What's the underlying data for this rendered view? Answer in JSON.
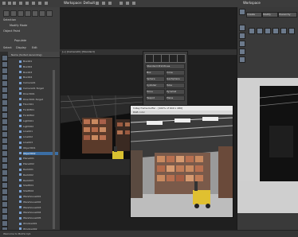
{
  "app": {
    "title": "Workspace: Default",
    "right_title": "Workspace"
  },
  "ribbon": {
    "labels": [
      "Selection",
      "Modify Mode",
      "Object Paint",
      "Populate"
    ],
    "subtabs": [
      "Select",
      "Display",
      "Edit"
    ]
  },
  "viewport": {
    "label": "[+] [Camera01] [Standard]"
  },
  "explorer": {
    "header": "Name (Sorted Ascending)",
    "rows": [
      "Box001",
      "Box002",
      "Box003",
      "Box004",
      "Camera01",
      "Camera01.Target",
      "Direct001",
      "Direct001.Target",
      "Floor001",
      "Forklift01",
      "Forklift02",
      "Light001",
      "Light002",
      "Line001",
      "Line002",
      "Line003",
      "Object001",
      "Object002",
      "Plane001",
      "Plane002",
      "Rack001",
      "Rack002",
      "Rack003",
      "Shelf001",
      "Shelf002",
      "Warehouse001",
      "Warehouse002",
      "Warehouse003",
      "Warehouse004",
      "Warehouse005",
      "Window001",
      "Window002"
    ],
    "selected_index": 17
  },
  "matpanel": {
    "title": "Standard Primitives",
    "buttons": [
      "Box",
      "Cone",
      "Sphere",
      "GeoSphere",
      "Cylinder",
      "Tube",
      "Torus",
      "Pyramid",
      "Teapot",
      "Plane"
    ]
  },
  "vfb": {
    "title": "V-Ray frame buffer - [100% of 640 x 480]",
    "channel": "RGB color"
  },
  "rpanel": {
    "tabs": [
      "Create",
      "Modify",
      "Hierarchy"
    ]
  },
  "statusbar": {
    "text": "Welcome to MAXScript."
  }
}
